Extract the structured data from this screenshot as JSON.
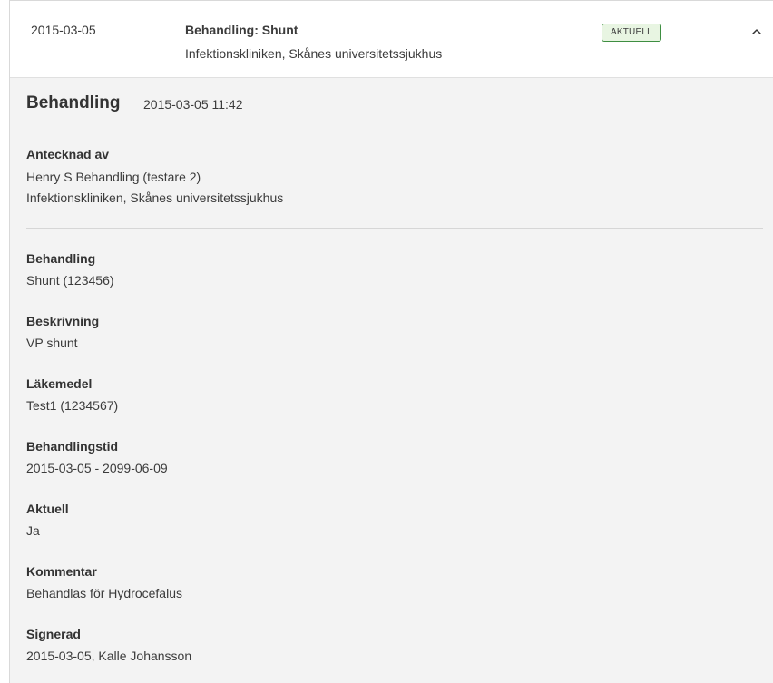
{
  "row": {
    "date": "2015-03-05",
    "title": "Behandling: Shunt",
    "subtitle": "Infektionskliniken, Skånes universitetssjukhus",
    "status": "AKTUELL",
    "expanded_icon": "chevron-up-icon"
  },
  "detail": {
    "heading": "Behandling",
    "timestamp": "2015-03-05 11:42",
    "author": {
      "label": "Antecknad av",
      "name": "Henry S Behandling (testare 2)",
      "unit": "Infektionskliniken, Skånes universitetssjukhus"
    },
    "fields": [
      {
        "label": "Behandling",
        "value": "Shunt (123456)"
      },
      {
        "label": "Beskrivning",
        "value": "VP shunt"
      },
      {
        "label": "Läkemedel",
        "value": "Test1 (1234567)"
      },
      {
        "label": "Behandlingstid",
        "value": "2015-03-05 - 2099-06-09"
      },
      {
        "label": "Aktuell",
        "value": "Ja"
      },
      {
        "label": "Kommentar",
        "value": "Behandlas för Hydrocefalus"
      },
      {
        "label": "Signerad",
        "value": "2015-03-05, Kalle Johansson"
      }
    ]
  },
  "colors": {
    "badge_border": "#3e8e41",
    "badge_background": "#e8f5e2",
    "detail_background": "#f3f3f3"
  }
}
